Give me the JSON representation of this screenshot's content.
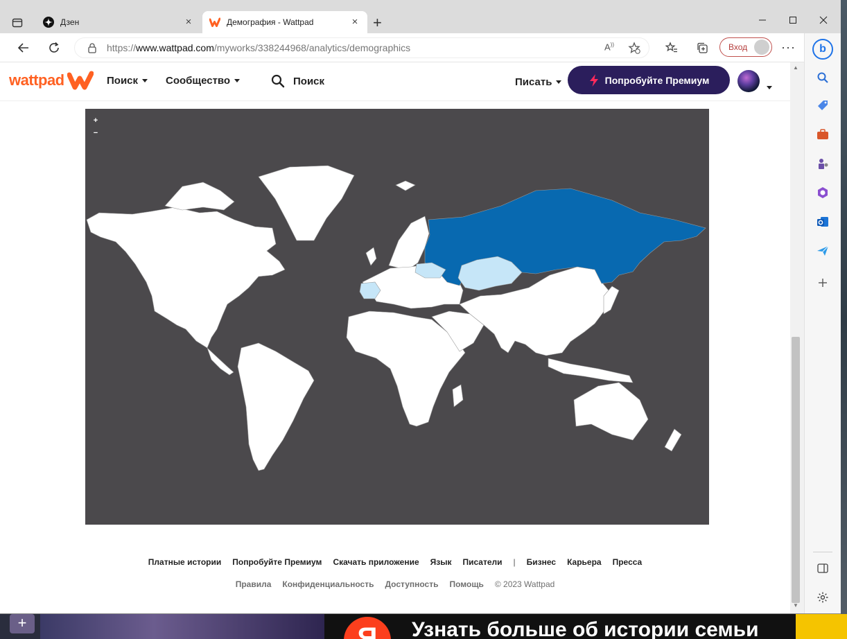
{
  "browser": {
    "tabs": [
      {
        "title": "Дзен",
        "favicon": "dzen-icon",
        "active": false
      },
      {
        "title": "Демография - Wattpad",
        "favicon": "wattpad-icon",
        "active": true
      }
    ],
    "url": {
      "prefix": "https://",
      "host": "www.wattpad.com",
      "path": "/myworks/338244968/analytics/demographics"
    },
    "signin_label": "Вход"
  },
  "header": {
    "logo_text": "wattpad",
    "nav": {
      "browse": "Поиск",
      "community": "Сообщество"
    },
    "search_label": "Поиск",
    "write_label": "Писать",
    "premium_label": "Попробуйте Премиум"
  },
  "map": {
    "zoom_in": "+",
    "zoom_out": "−",
    "colors": {
      "background": "#4b494c",
      "land": "#ffffff",
      "high": "#0869b0",
      "low": "#c6e6f8"
    },
    "highlighted": [
      {
        "country": "Russia",
        "level": "high"
      },
      {
        "country": "Ukraine",
        "level": "low"
      },
      {
        "country": "Kazakhstan",
        "level": "low"
      },
      {
        "country": "Spain",
        "level": "low"
      }
    ]
  },
  "footer": {
    "row1": [
      "Платные истории",
      "Попробуйте Премиум",
      "Скачать приложение",
      "Язык",
      "Писатели",
      "|",
      "Бизнес",
      "Карьера",
      "Пресса"
    ],
    "row2": [
      "Правила",
      "Конфиденциальность",
      "Доступность",
      "Помощь"
    ],
    "copyright": "© 2023 Wattpad"
  },
  "taskbar": {
    "banner_logo": "Я",
    "banner_text": "Узнать больше об истории семьи"
  }
}
